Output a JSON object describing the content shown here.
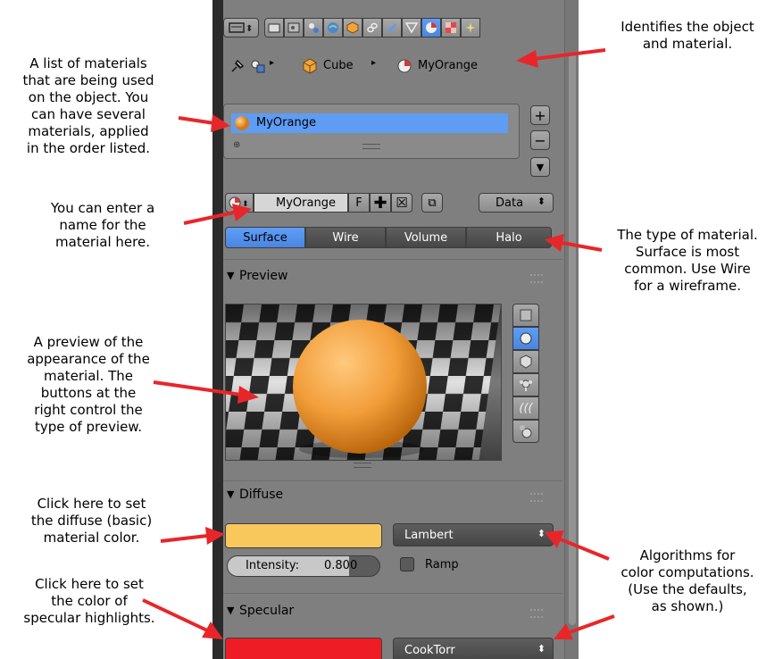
{
  "annotations": {
    "identifies": "Identifies the object\nand material.",
    "list": "A list of materials\nthat are being used\non the object.  You\ncan have several\nmaterials, applied\nin the order listed.",
    "name": "You can enter a\nname for the\nmaterial here.",
    "type": "The type of material.\nSurface is most\ncommon.  Use Wire\nfor a wireframe.",
    "preview": "A preview of the\nappearance of the\nmaterial.  The\nbuttons at the\nright control the\ntype of preview.",
    "diffuse": "Click here to set\nthe diffuse (basic)\nmaterial color.",
    "algorithms": "Algorithms for\ncolor computations.\n(Use the defaults,\nas shown.)",
    "specular": "Click here to set\nthe color of\nspecular highlights."
  },
  "breadcrumb": {
    "object": "Cube",
    "material": "MyOrange"
  },
  "material_slots": [
    "MyOrange"
  ],
  "datablock": {
    "name": "MyOrange",
    "fake_user": "F",
    "link": "Data"
  },
  "material_type_tabs": [
    {
      "label": "Surface",
      "selected": true
    },
    {
      "label": "Wire",
      "selected": false
    },
    {
      "label": "Volume",
      "selected": false
    },
    {
      "label": "Halo",
      "selected": false
    }
  ],
  "preview": {
    "title": "Preview",
    "shape_buttons": [
      "flat-icon",
      "sphere-icon",
      "cube-icon",
      "monkey-icon",
      "hair-icon",
      "sphere-sky-icon"
    ],
    "selected_shape": "sphere-icon"
  },
  "diffuse": {
    "title": "Diffuse",
    "color": "#f9c85d",
    "shader": "Lambert",
    "intensity_label": "Intensity:",
    "intensity_value": "0.800",
    "intensity": 0.8,
    "ramp_label": "Ramp"
  },
  "specular": {
    "title": "Specular",
    "color": "#ee1c24",
    "shader": "CookTorr"
  },
  "colors": {
    "arrow": "#e8262a",
    "selected": "#5680c2",
    "panel": "#7f7f7f",
    "orange": "#f2a03c"
  }
}
